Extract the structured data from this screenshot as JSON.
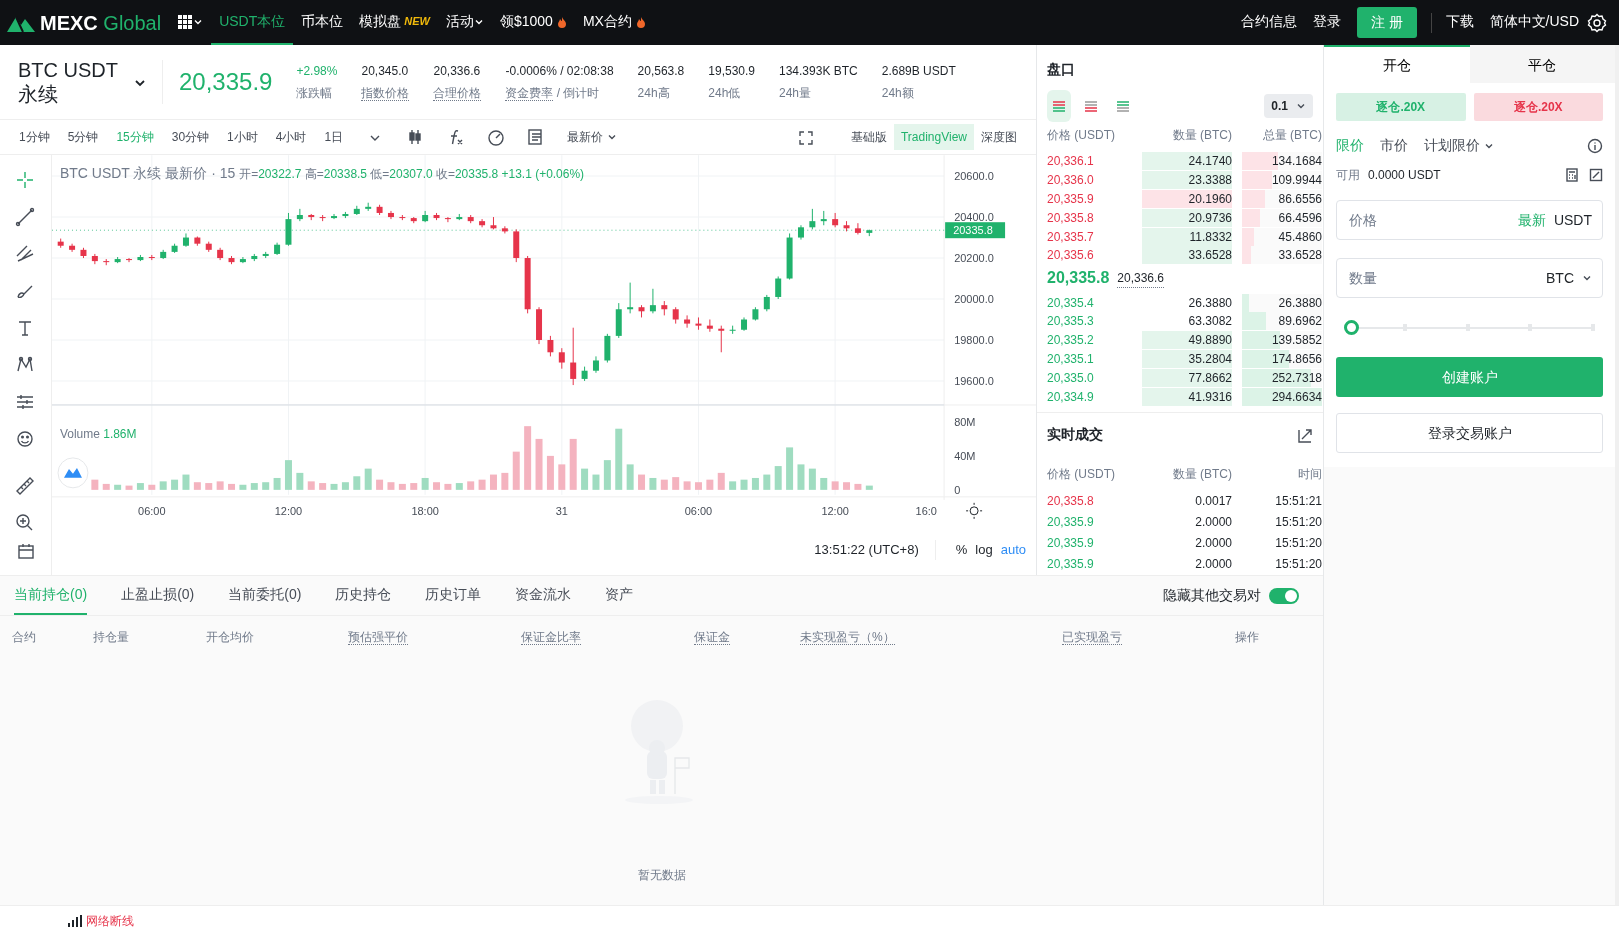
{
  "top_nav": {
    "logo": {
      "brand": "MEXC",
      "suffix": "Global"
    },
    "items": [
      {
        "label": "USDT本位",
        "selected": true,
        "kind": "plain"
      },
      {
        "label": "币本位",
        "selected": false,
        "kind": "plain"
      },
      {
        "label": "模拟盘",
        "selected": false,
        "kind": "badge",
        "badge": "NEW"
      },
      {
        "label": "活动",
        "selected": false,
        "kind": "menu"
      },
      {
        "label": "领$1000",
        "selected": false,
        "kind": "hot"
      },
      {
        "label": "MX合约",
        "selected": false,
        "kind": "hot"
      }
    ],
    "links": [
      "合约信息",
      "登录"
    ],
    "register": "注 册",
    "links_right": [
      "下载",
      "简体中文/USD"
    ]
  },
  "ticker": {
    "symbol": "BTC USDT",
    "contract": "永续",
    "price": "20,335.9",
    "stats": [
      {
        "value": "+2.98%",
        "label": "涨跌幅",
        "kind": "up",
        "dotted": false
      },
      {
        "value": "20,345.0",
        "label": "指数价格",
        "kind": "plain",
        "dotted": true
      },
      {
        "value": "20,336.6",
        "label": "合理价格",
        "kind": "plain",
        "dotted": true
      },
      {
        "value": "-0.0006% / 02:08:38",
        "label": "资金费率",
        "label_suffix": " / 倒计时",
        "kind": "plain",
        "dotted": true
      },
      {
        "value": "20,563.8",
        "label": "24h高",
        "kind": "plain",
        "dotted": false
      },
      {
        "value": "19,530.9",
        "label": "24h低",
        "kind": "plain",
        "dotted": false
      },
      {
        "value": "134.393K BTC",
        "label": "24h量",
        "kind": "plain",
        "dotted": false
      },
      {
        "value": "2.689B USDT",
        "label": "24h额",
        "kind": "plain",
        "dotted": false
      }
    ]
  },
  "chart_toolbar": {
    "intervals": [
      {
        "label": "1分钟",
        "selected": false
      },
      {
        "label": "5分钟",
        "selected": false
      },
      {
        "label": "15分钟",
        "selected": true
      },
      {
        "label": "30分钟",
        "selected": false
      },
      {
        "label": "1小时",
        "selected": false
      },
      {
        "label": "4小时",
        "selected": false
      },
      {
        "label": "1日",
        "selected": false
      }
    ],
    "price_type": "最新价",
    "views": [
      {
        "label": "基础版",
        "selected": false
      },
      {
        "label": "TradingView",
        "selected": true
      },
      {
        "label": "深度图",
        "selected": false
      }
    ]
  },
  "chart": {
    "legend_title": "BTC USDT 永续 最新价 · 15",
    "ohlc": [
      {
        "label": "开=",
        "value": "20322.7"
      },
      {
        "label": "高=",
        "value": "20338.5"
      },
      {
        "label": "低=",
        "value": "20307.0"
      },
      {
        "label": "收=",
        "value": "20335.8"
      }
    ],
    "change": "+13.1 (+0.06%)",
    "last_price": "20335.8",
    "price": {
      "chart_data": {
        "type": "candlestick",
        "categories": [
          null,
          null,
          null,
          null,
          null,
          null,
          null,
          null,
          null,
          null,
          null,
          null,
          null,
          null,
          null,
          null,
          null,
          null,
          null,
          null,
          null,
          null,
          null,
          null,
          null,
          null,
          null,
          null,
          null,
          null,
          null,
          null,
          null,
          null,
          null,
          null,
          null,
          null,
          null,
          null,
          null,
          null,
          null,
          null,
          null,
          null,
          null,
          null,
          null,
          null,
          null,
          null,
          null,
          null,
          null,
          null,
          null,
          null,
          null,
          null,
          null,
          null,
          null,
          null,
          null,
          null,
          null,
          null,
          null,
          null,
          null,
          null,
          null,
          null,
          null,
          null,
          null
        ],
        "ohlc": [
          [
            20280,
            20295,
            20250,
            20260
          ],
          [
            20260,
            20270,
            20230,
            20240
          ],
          [
            20240,
            20250,
            20200,
            20210
          ],
          [
            20210,
            20220,
            20170,
            20185
          ],
          [
            20185,
            20195,
            20165,
            20180
          ],
          [
            20180,
            20205,
            20175,
            20195
          ],
          [
            20195,
            20200,
            20180,
            20190
          ],
          [
            20190,
            20215,
            20185,
            20205
          ],
          [
            20205,
            20215,
            20190,
            20200
          ],
          [
            20200,
            20240,
            20195,
            20230
          ],
          [
            20230,
            20270,
            20225,
            20260
          ],
          [
            20260,
            20320,
            20255,
            20300
          ],
          [
            20300,
            20305,
            20260,
            20270
          ],
          [
            20270,
            20280,
            20230,
            20240
          ],
          [
            20240,
            20250,
            20190,
            20200
          ],
          [
            20200,
            20210,
            20170,
            20180
          ],
          [
            20180,
            20205,
            20175,
            20195
          ],
          [
            20195,
            20220,
            20185,
            20210
          ],
          [
            20210,
            20230,
            20200,
            20220
          ],
          [
            20220,
            20275,
            20215,
            20265
          ],
          [
            20265,
            20420,
            20260,
            20390
          ],
          [
            20390,
            20440,
            20380,
            20410
          ],
          [
            20410,
            20415,
            20385,
            20400
          ],
          [
            20400,
            20410,
            20380,
            20395
          ],
          [
            20395,
            20415,
            20390,
            20405
          ],
          [
            20405,
            20425,
            20395,
            20415
          ],
          [
            20415,
            20455,
            20410,
            20440
          ],
          [
            20440,
            20470,
            20430,
            20450
          ],
          [
            20450,
            20460,
            20410,
            20420
          ],
          [
            20420,
            20430,
            20390,
            20400
          ],
          [
            20400,
            20410,
            20385,
            20395
          ],
          [
            20395,
            20400,
            20370,
            20380
          ],
          [
            20380,
            20430,
            20375,
            20410
          ],
          [
            20410,
            20420,
            20385,
            20395
          ],
          [
            20395,
            20400,
            20375,
            20390
          ],
          [
            20390,
            20415,
            20385,
            20400
          ],
          [
            20400,
            20410,
            20370,
            20380
          ],
          [
            20380,
            20390,
            20350,
            20360
          ],
          [
            20360,
            20400,
            20340,
            20345
          ],
          [
            20345,
            20355,
            20320,
            20330
          ],
          [
            20330,
            20340,
            20180,
            20200
          ],
          [
            20200,
            20210,
            19930,
            19950
          ],
          [
            19950,
            19960,
            19780,
            19800
          ],
          [
            19800,
            19820,
            19720,
            19740
          ],
          [
            19740,
            19760,
            19660,
            19690
          ],
          [
            19690,
            19860,
            19580,
            19610
          ],
          [
            19610,
            19670,
            19600,
            19650
          ],
          [
            19650,
            19720,
            19640,
            19700
          ],
          [
            19700,
            19830,
            19690,
            19820
          ],
          [
            19820,
            19980,
            19810,
            19950
          ],
          [
            19950,
            20080,
            19930,
            19960
          ],
          [
            19960,
            19970,
            19910,
            19940
          ],
          [
            19940,
            20050,
            19930,
            19970
          ],
          [
            19970,
            19990,
            19920,
            19950
          ],
          [
            19950,
            19960,
            19880,
            19900
          ],
          [
            19900,
            19920,
            19860,
            19880
          ],
          [
            19880,
            19910,
            19850,
            19870
          ],
          [
            19870,
            19900,
            19840,
            19855
          ],
          [
            19855,
            19870,
            19740,
            19845
          ],
          [
            19845,
            19870,
            19830,
            19850
          ],
          [
            19850,
            19910,
            19845,
            19900
          ],
          [
            19900,
            19960,
            19895,
            19950
          ],
          [
            19950,
            20020,
            19940,
            20010
          ],
          [
            20010,
            20110,
            20000,
            20100
          ],
          [
            20100,
            20320,
            20095,
            20300
          ],
          [
            20300,
            20360,
            20290,
            20350
          ],
          [
            20350,
            20440,
            20340,
            20380
          ],
          [
            20380,
            20430,
            20360,
            20390
          ],
          [
            20390,
            20420,
            20350,
            20360
          ],
          [
            20360,
            20380,
            20330,
            20345
          ],
          [
            20345,
            20370,
            20315,
            20322.7
          ],
          [
            20322.7,
            20338.5,
            20307.0,
            20335.8
          ],
          null,
          null,
          null,
          null,
          null
        ],
        "ylim": [
          19483,
          20702
        ],
        "yticks": [
          {
            "value": 20600,
            "label": "20600.0"
          },
          {
            "value": 20400,
            "label": "20400.0"
          },
          {
            "value": 20200,
            "label": "20200.0"
          },
          {
            "value": 20000,
            "label": "20000.0"
          },
          {
            "value": 19800,
            "label": "19800.0"
          },
          {
            "value": 19600,
            "label": "19600.0"
          }
        ]
      }
    },
    "volume": {
      "label": "Volume",
      "value": "1.86M",
      "chart_data": {
        "type": "bar",
        "categories": [
          null,
          null,
          null,
          null,
          null,
          null,
          null,
          null,
          "06:00",
          null,
          null,
          null,
          null,
          null,
          null,
          null,
          null,
          null,
          null,
          null,
          "12:00",
          null,
          null,
          null,
          null,
          null,
          null,
          null,
          null,
          null,
          null,
          null,
          "18:00",
          null,
          null,
          null,
          null,
          null,
          null,
          null,
          null,
          null,
          null,
          null,
          "31",
          null,
          null,
          null,
          null,
          null,
          null,
          null,
          null,
          null,
          null,
          null,
          "06:00",
          null,
          null,
          null,
          null,
          null,
          null,
          null,
          null,
          null,
          null,
          null,
          "12:00",
          null,
          null,
          null,
          null,
          null,
          null,
          null,
          "16:0"
        ],
        "values": [
          null,
          null,
          null,
          12,
          7,
          6,
          5,
          8,
          6,
          10,
          12,
          18,
          9,
          8,
          10,
          7,
          6,
          8,
          9,
          14,
          35,
          20,
          10,
          8,
          7,
          9,
          16,
          25,
          12,
          9,
          7,
          8,
          14,
          9,
          7,
          8,
          10,
          12,
          18,
          20,
          45,
          75,
          60,
          40,
          30,
          60,
          25,
          18,
          35,
          72,
          30,
          18,
          14,
          12,
          15,
          10,
          9,
          12,
          20,
          10,
          12,
          14,
          18,
          28,
          50,
          30,
          25,
          14,
          10,
          9,
          7,
          5,
          null,
          null,
          null,
          null,
          null
        ],
        "ylim": [
          0,
          100
        ],
        "yticks": [
          {
            "value": 80,
            "label": "80M"
          },
          {
            "value": 40,
            "label": "40M"
          },
          {
            "value": 0,
            "label": "0"
          }
        ]
      }
    },
    "clock": "13:51:22 (UTC+8)",
    "scale_options": [
      {
        "label": "%",
        "selected": false
      },
      {
        "label": "log",
        "selected": false
      },
      {
        "label": "auto",
        "selected": true
      }
    ]
  },
  "orderbook": {
    "title": "盘口",
    "step": "0.1",
    "columns": [
      "价格 (USDT)",
      "数量 (BTC)",
      "总量 (BTC)"
    ],
    "asks": [
      {
        "price": "20,336.1",
        "qty": "24.1740",
        "total": "134.1684",
        "color": "#e4f5ec",
        "level": 0.45
      },
      {
        "price": "20,336.0",
        "qty": "23.3388",
        "total": "109.9944",
        "color": "#e4f5ec",
        "level": 0.37
      },
      {
        "price": "20,335.9",
        "qty": "20.1960",
        "total": "86.6556",
        "color": "#fde3e7",
        "level": 0.29
      },
      {
        "price": "20,335.8",
        "qty": "20.9736",
        "total": "66.4596",
        "color": "#e4f5ec",
        "level": 0.22
      },
      {
        "price": "20,335.7",
        "qty": "11.8332",
        "total": "45.4860",
        "color": "#e4f5ec",
        "level": 0.15
      },
      {
        "price": "20,335.6",
        "qty": "33.6528",
        "total": "33.6528",
        "color": "#e4f5ec",
        "level": 0.11
      }
    ],
    "last": "20,335.8",
    "fair": "20,336.6",
    "bids": [
      {
        "price": "20,335.4",
        "qty": "26.3880",
        "total": "26.3880",
        "level": 0.09
      },
      {
        "price": "20,335.3",
        "qty": "63.3082",
        "total": "89.6962",
        "level": 0.3
      },
      {
        "price": "20,335.2",
        "qty": "49.8890",
        "total": "139.5852",
        "color": "#e4f5ec",
        "level": 0.47
      },
      {
        "price": "20,335.1",
        "qty": "35.2804",
        "total": "174.8656",
        "color": "#e4f5ec",
        "level": 0.59
      },
      {
        "price": "20,335.0",
        "qty": "77.8662",
        "total": "252.7318",
        "color": "#e4f5ec",
        "level": 0.86
      },
      {
        "price": "20,334.9",
        "qty": "41.9316",
        "total": "294.6634",
        "color": "#e4f5ec",
        "level": 1.0
      }
    ]
  },
  "trades": {
    "title": "实时成交",
    "columns": [
      "价格 (USDT)",
      "数量 (BTC)",
      "时间"
    ],
    "rows": [
      {
        "price": "20,335.8",
        "qty": "0.0017",
        "time": "15:51:21",
        "color": "#e6344a"
      },
      {
        "price": "20,335.9",
        "qty": "2.0000",
        "time": "15:51:20",
        "color": "#20b26c"
      },
      {
        "price": "20,335.9",
        "qty": "2.0000",
        "time": "15:51:20",
        "color": "#20b26c"
      },
      {
        "price": "20,335.9",
        "qty": "2.0000",
        "time": "15:51:20",
        "color": "#20b26c"
      }
    ]
  },
  "order_form": {
    "tabs": [
      {
        "label": "开仓",
        "selected": true
      },
      {
        "label": "平仓",
        "selected": false
      }
    ],
    "leverage": [
      {
        "label": "逐仓.20X",
        "color": "#20b26c"
      },
      {
        "label": "逐仓.20X",
        "color": "#e6344a"
      }
    ],
    "order_types": [
      {
        "label": "限价",
        "selected": true,
        "kind": "plain"
      },
      {
        "label": "市价",
        "selected": false,
        "kind": "plain"
      },
      {
        "label": "计划限价",
        "selected": false,
        "kind": "menu"
      }
    ],
    "available_label": "可用",
    "available": "0.0000 USDT",
    "price_field": {
      "placeholder": "价格",
      "action": "最新",
      "unit": "USDT"
    },
    "qty_field": {
      "placeholder": "数量",
      "unit": "BTC"
    },
    "slider": {
      "level": 0
    },
    "primary": "创建账户",
    "secondary": "登录交易账户"
  },
  "positions": {
    "tabs": [
      {
        "label": "当前持仓(0)",
        "selected": true
      },
      {
        "label": "止盈止损(0)",
        "selected": false
      },
      {
        "label": "当前委托(0)",
        "selected": false
      },
      {
        "label": "历史持仓",
        "selected": false
      },
      {
        "label": "历史订单",
        "selected": false
      },
      {
        "label": "资金流水",
        "selected": false
      },
      {
        "label": "资产",
        "selected": false
      }
    ],
    "hide_others": {
      "label": "隐藏其他交易对",
      "on": true
    },
    "columns": [
      {
        "label": "合约",
        "dotted": false
      },
      {
        "label": "持仓量",
        "dotted": false
      },
      {
        "label": "开仓均价",
        "dotted": false
      },
      {
        "label": "预估强平价",
        "dotted": true
      },
      {
        "label": "保证金比率",
        "dotted": true
      },
      {
        "label": "保证金",
        "dotted": true
      },
      {
        "label": "未实现盈亏（%）",
        "dotted": true
      },
      {
        "label": "已实现盈亏",
        "dotted": true
      },
      {
        "label": "操作",
        "dotted": false
      }
    ],
    "empty": "暂无数据"
  },
  "status_bar": {
    "network": "网络断线"
  }
}
